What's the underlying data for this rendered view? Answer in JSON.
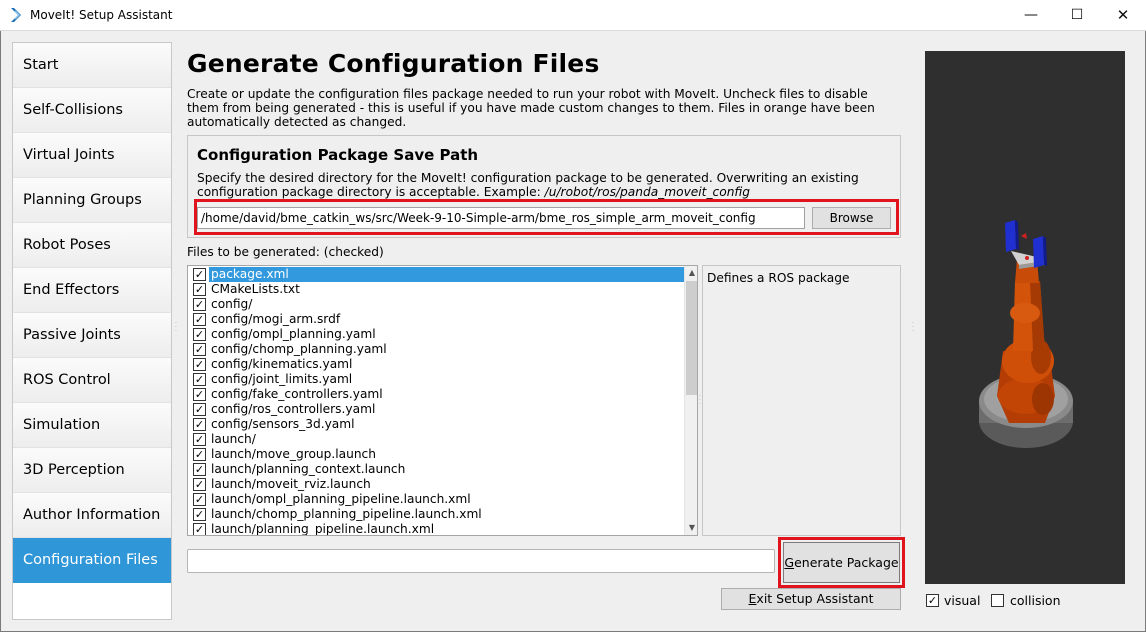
{
  "window": {
    "title": "MoveIt! Setup Assistant",
    "minimize": "—",
    "maximize": "☐",
    "close": "✕"
  },
  "sidebar": {
    "items": [
      {
        "label": "Start"
      },
      {
        "label": "Self-Collisions"
      },
      {
        "label": "Virtual Joints"
      },
      {
        "label": "Planning Groups"
      },
      {
        "label": "Robot Poses"
      },
      {
        "label": "End Effectors"
      },
      {
        "label": "Passive Joints"
      },
      {
        "label": "ROS Control"
      },
      {
        "label": "Simulation"
      },
      {
        "label": "3D Perception"
      },
      {
        "label": "Author Information"
      },
      {
        "label": "Configuration Files",
        "active": true
      }
    ]
  },
  "main": {
    "title": "Generate Configuration Files",
    "description": "Create or update the configuration files package needed to run your robot with MoveIt. Uncheck files to disable them from being generated - this is useful if you have made custom changes to them. Files in orange have been automatically detected as changed.",
    "save_path": {
      "title": "Configuration Package Save Path",
      "description": "Specify the desired directory for the MoveIt! configuration package to be generated. Overwriting an existing configuration package directory is acceptable. Example: ",
      "example": "/u/robot/ros/panda_moveit_config",
      "value": "/home/david/bme_catkin_ws/src/Week-9-10-Simple-arm/bme_ros_simple_arm_moveit_config",
      "browse_label": "Browse"
    },
    "files_label": "Files to be generated: (checked)",
    "files": [
      {
        "name": "package.xml",
        "checked": true,
        "selected": true
      },
      {
        "name": "CMakeLists.txt",
        "checked": true
      },
      {
        "name": "config/",
        "checked": true
      },
      {
        "name": "config/mogi_arm.srdf",
        "checked": true
      },
      {
        "name": "config/ompl_planning.yaml",
        "checked": true
      },
      {
        "name": "config/chomp_planning.yaml",
        "checked": true
      },
      {
        "name": "config/kinematics.yaml",
        "checked": true
      },
      {
        "name": "config/joint_limits.yaml",
        "checked": true
      },
      {
        "name": "config/fake_controllers.yaml",
        "checked": true
      },
      {
        "name": "config/ros_controllers.yaml",
        "checked": true
      },
      {
        "name": "config/sensors_3d.yaml",
        "checked": true
      },
      {
        "name": "launch/",
        "checked": true
      },
      {
        "name": "launch/move_group.launch",
        "checked": true
      },
      {
        "name": "launch/planning_context.launch",
        "checked": true
      },
      {
        "name": "launch/moveit_rviz.launch",
        "checked": true
      },
      {
        "name": "launch/ompl_planning_pipeline.launch.xml",
        "checked": true
      },
      {
        "name": "launch/chomp_planning_pipeline.launch.xml",
        "checked": true
      },
      {
        "name": "launch/planning_pipeline.launch.xml",
        "checked": true
      }
    ],
    "file_description": "Defines a ROS package",
    "generate_label": "Generate Package",
    "generate_mnemonic": "G",
    "exit_label": "Exit Setup Assistant",
    "exit_mnemonic": "E"
  },
  "viewer": {
    "visual_label": "visual",
    "visual_checked": true,
    "collision_label": "collision",
    "collision_checked": false
  },
  "colors": {
    "active_nav": "#2f96d8",
    "highlight_box": "#e0141c",
    "selected_row": "#3399de",
    "robot_body": "#d04a08",
    "gripper": "#1f2fd0",
    "viewport_bg": "#2f2f2f"
  }
}
